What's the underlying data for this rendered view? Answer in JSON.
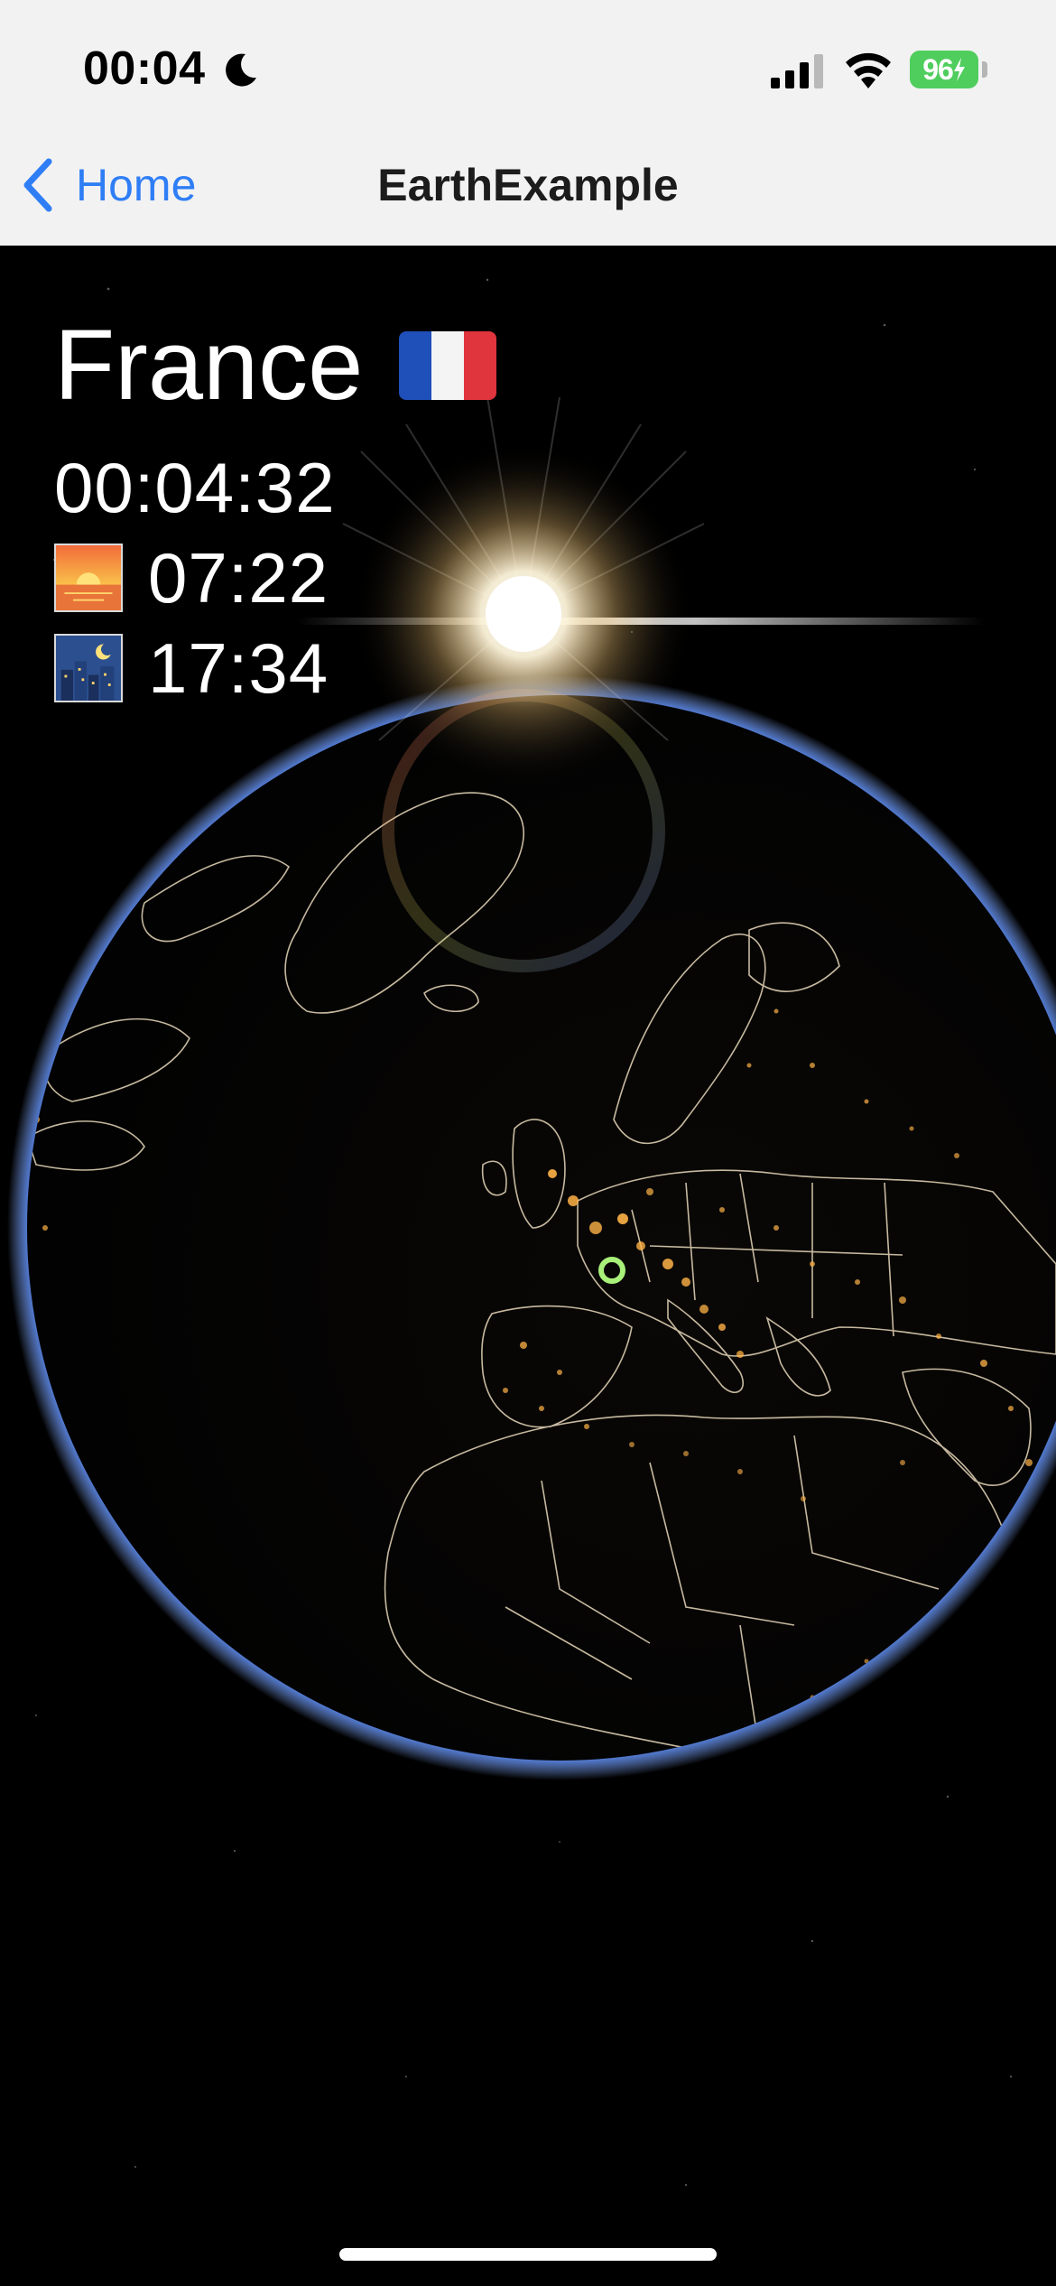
{
  "status_bar": {
    "time": "00:04",
    "battery": "96",
    "icons": [
      "moon-icon",
      "cellular-signal-icon",
      "wifi-icon",
      "battery-charging-icon"
    ]
  },
  "nav": {
    "back_label": "Home",
    "title": "EarthExample"
  },
  "location": {
    "country": "France",
    "flag": "flag-france-icon",
    "current_time": "00:04:32",
    "sunrise": "07:22",
    "sunset": "17:34",
    "sunrise_icon": "sunrise-icon",
    "sunset_icon": "night-city-icon"
  },
  "colors": {
    "nav_bg": "#f2f2f2",
    "link_blue": "#2f7ef6",
    "battery_green": "#4fcd5d",
    "marker_green": "#a8f07a",
    "city_lights": "#ffb347"
  }
}
